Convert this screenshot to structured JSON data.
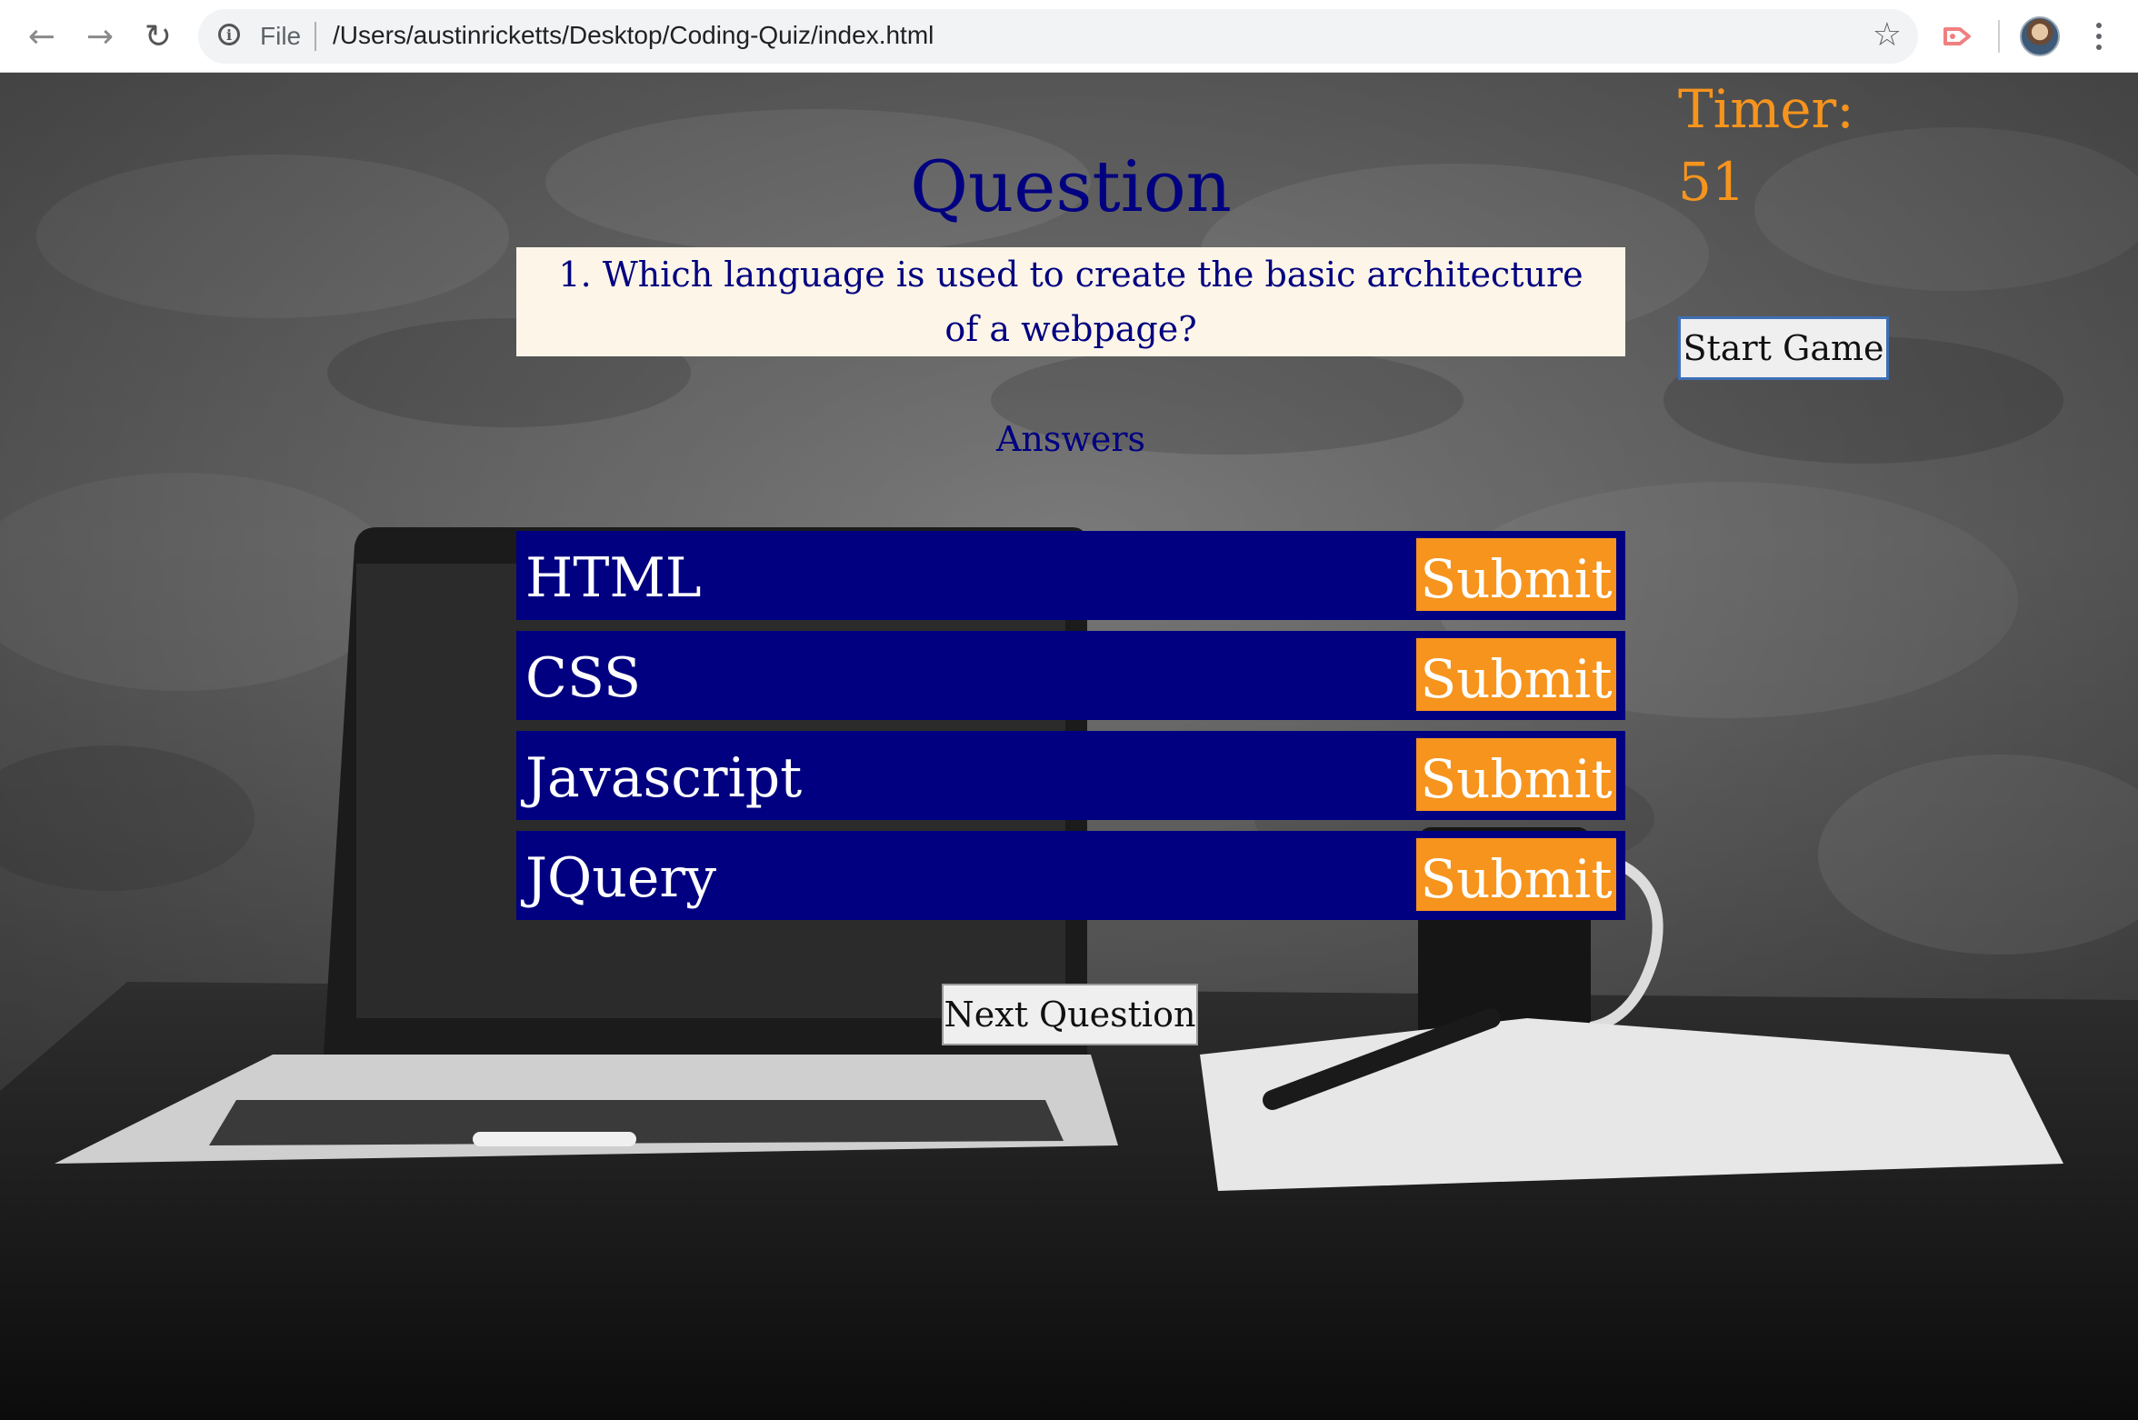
{
  "browser": {
    "scheme_label": "File",
    "url": "/Users/austinricketts/Desktop/Coding-Quiz/index.html",
    "icons": {
      "back": "arrow-left-icon",
      "forward": "arrow-right-icon",
      "reload": "reload-icon",
      "info": "info-icon",
      "bookmark": "star-icon",
      "extension": "cast-extension-icon",
      "profile": "avatar",
      "menu": "kebab-menu-icon"
    }
  },
  "quiz": {
    "timer_label": "Timer:",
    "timer_value": "51",
    "start_label": "Start Game",
    "heading": "Question",
    "question": "1. Which language is used to create the basic architecture of a webpage?",
    "answers_label": "Answers",
    "answers": [
      {
        "text": "HTML",
        "submit": "Submit"
      },
      {
        "text": "CSS",
        "submit": "Submit"
      },
      {
        "text": "Javascript",
        "submit": "Submit"
      },
      {
        "text": "JQuery",
        "submit": "Submit"
      }
    ],
    "next_label": "Next Question"
  },
  "colors": {
    "accent_navy": "#000080",
    "accent_orange": "#f7941d",
    "question_bg": "#fcf5e8"
  }
}
